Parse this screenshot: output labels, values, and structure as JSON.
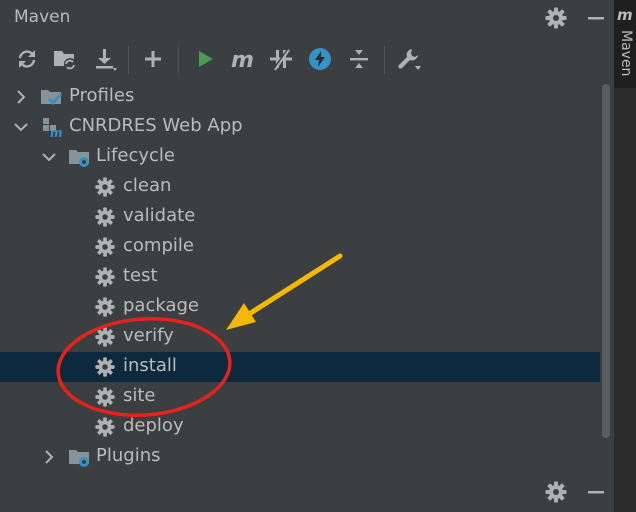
{
  "panel": {
    "title": "Maven",
    "title_icons": [
      "gear-icon",
      "minimize-icon"
    ],
    "side_tab_label": "Maven",
    "side_tab_icon": "maven-m-icon"
  },
  "toolbar": {
    "buttons": [
      {
        "name": "reload-all-projects-button",
        "icon": "refresh-icon"
      },
      {
        "name": "generate-sources-button",
        "icon": "folder-refresh-icon"
      },
      {
        "name": "download-sources-button",
        "icon": "download-icon"
      },
      {
        "name": "add-maven-project-button",
        "icon": "plus-icon"
      },
      {
        "name": "run-maven-build-button",
        "icon": "play-icon"
      },
      {
        "name": "execute-maven-goal-button",
        "icon": "maven-m-icon"
      },
      {
        "name": "toggle-offline-mode-button",
        "icon": "offline-icon"
      },
      {
        "name": "skip-tests-button",
        "icon": "lightning-icon"
      },
      {
        "name": "collapse-all-button",
        "icon": "collapse-icon"
      },
      {
        "name": "maven-settings-button",
        "icon": "wrench-icon"
      }
    ]
  },
  "tree": {
    "profiles": "Profiles",
    "project": "CNRDRES Web App",
    "lifecycle": "Lifecycle",
    "goals": [
      "clean",
      "validate",
      "compile",
      "test",
      "package",
      "verify",
      "install",
      "site",
      "deploy"
    ],
    "selected_goal": "install",
    "plugins": "Plugins"
  },
  "colors": {
    "background": "#3c3f41",
    "selection": "#0d293e",
    "text": "#bbbbbb",
    "run_green": "#499c54",
    "skip_tests_blue": "#3592c4",
    "annotation_red": "#e8221b",
    "annotation_arrow": "#f5b800"
  }
}
